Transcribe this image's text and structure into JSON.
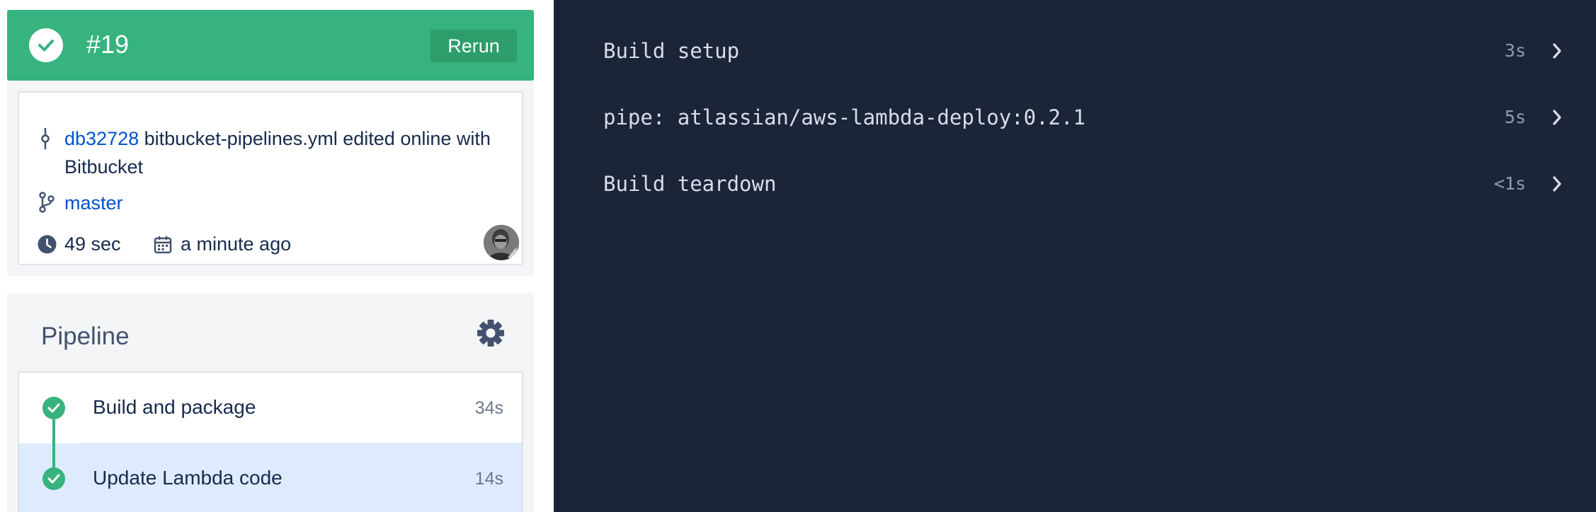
{
  "run": {
    "number": "#19",
    "rerun_label": "Rerun",
    "status": "success",
    "status_color": "#36B37E"
  },
  "commit": {
    "hash": "db32728",
    "message": " bitbucket-pipelines.yml edited online with Bitbucket",
    "branch": "master",
    "duration": "49 sec",
    "time_ago": "a minute ago",
    "author_avatar": "avatar"
  },
  "pipeline": {
    "title": "Pipeline",
    "steps": [
      {
        "name": "Build and package",
        "duration": "34s",
        "status": "success"
      },
      {
        "name": "Update Lambda code",
        "duration": "14s",
        "status": "success"
      }
    ]
  },
  "log": {
    "sections": [
      {
        "label": "Build setup",
        "duration": "3s"
      },
      {
        "label": "pipe: atlassian/aws-lambda-deploy:0.2.1",
        "duration": "5s"
      },
      {
        "label": "Build teardown",
        "duration": "<1s"
      }
    ]
  },
  "colors": {
    "success": "#36B37E",
    "link": "#0052CC",
    "log_background": "#1C2538",
    "selected_row": "#DEEBFF"
  },
  "icons": {
    "status": "check-circle-icon",
    "commit": "commit-icon",
    "branch": "branch-icon",
    "duration": "clock-icon",
    "date": "calendar-icon",
    "settings": "gear-icon",
    "expand": "chevron-right-icon"
  }
}
